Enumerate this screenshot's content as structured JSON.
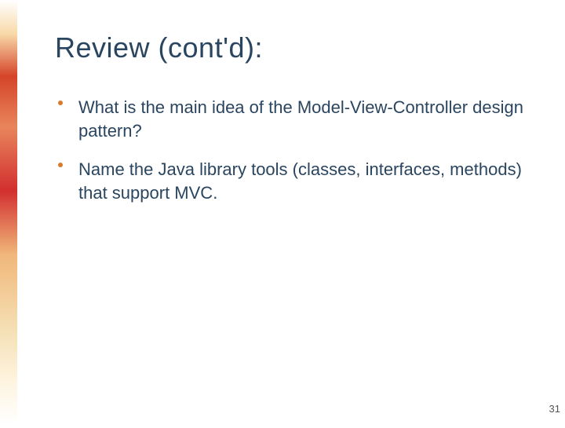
{
  "slide": {
    "title": "Review (cont'd):",
    "bullets": [
      "What is the main idea of the Model-View-Controller design pattern?",
      "Name the Java library tools (classes, interfaces, methods) that support MVC."
    ],
    "page_number": "31"
  },
  "colors": {
    "title": "#2a4560",
    "text": "#2a4560",
    "bullet": "#d77a2a"
  }
}
